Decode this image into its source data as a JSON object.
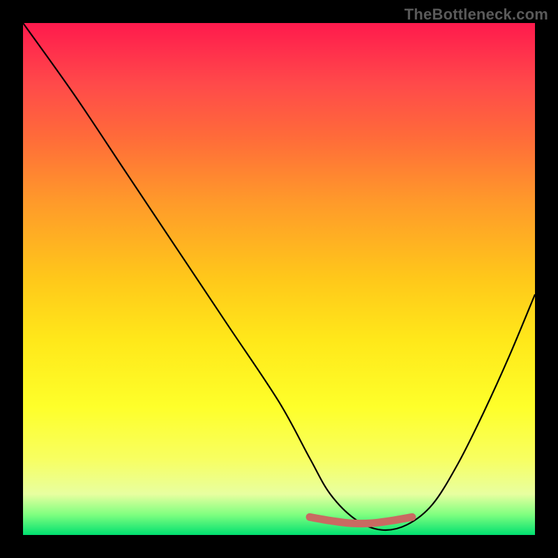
{
  "watermark": "TheBottleneck.com",
  "chart_data": {
    "type": "line",
    "title": "",
    "xlabel": "",
    "ylabel": "",
    "xlim": [
      0,
      100
    ],
    "ylim": [
      0,
      100
    ],
    "series": [
      {
        "name": "curve",
        "x": [
          0,
          10,
          20,
          30,
          40,
          50,
          56,
          60,
          65,
          70,
          75,
          80,
          85,
          90,
          95,
          100
        ],
        "y": [
          100,
          86,
          71,
          56,
          41,
          26,
          15,
          8,
          3,
          1,
          2,
          6,
          14,
          24,
          35,
          47
        ]
      },
      {
        "name": "highlight",
        "x": [
          56,
          60,
          64,
          68,
          72,
          76
        ],
        "y": [
          3.5,
          2.8,
          2.3,
          2.3,
          2.8,
          3.5
        ]
      }
    ]
  }
}
